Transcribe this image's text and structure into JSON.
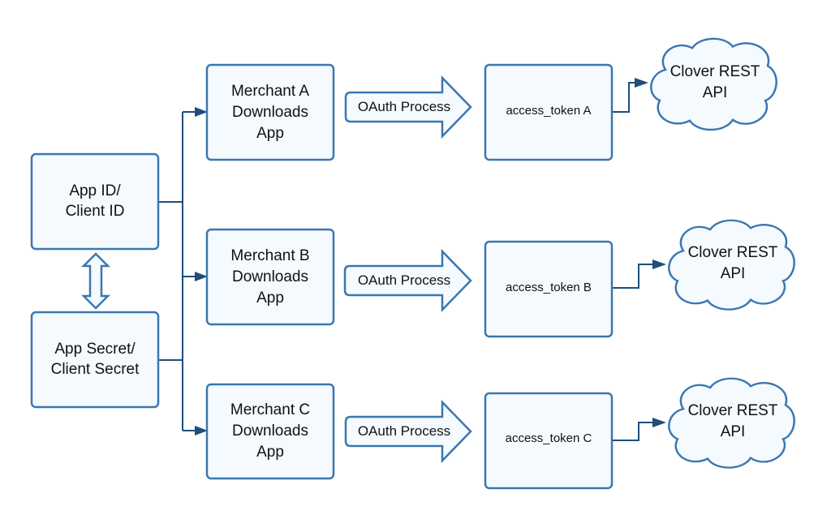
{
  "diagram": {
    "app_id": {
      "line1": "App ID/",
      "line2": "Client ID"
    },
    "app_secret": {
      "line1": "App Secret/",
      "line2": "Client Secret"
    },
    "merchants": [
      {
        "line1": "Merchant A",
        "line2": "Downloads",
        "line3": "App"
      },
      {
        "line1": "Merchant B",
        "line2": "Downloads",
        "line3": "App"
      },
      {
        "line1": "Merchant C",
        "line2": "Downloads",
        "line3": "App"
      }
    ],
    "oauth": [
      "OAuth Process",
      "OAuth Process",
      "OAuth Process"
    ],
    "tokens": [
      "access_token A",
      "access_token B",
      "access_token C"
    ],
    "apis": [
      {
        "line1": "Clover REST",
        "line2": "API"
      },
      {
        "line1": "Clover REST",
        "line2": "API"
      },
      {
        "line1": "Clover REST",
        "line2": "API"
      }
    ],
    "colors": {
      "stroke": "#3a77b0",
      "fill": "#f5faff",
      "connector": "#1f4e79"
    }
  }
}
